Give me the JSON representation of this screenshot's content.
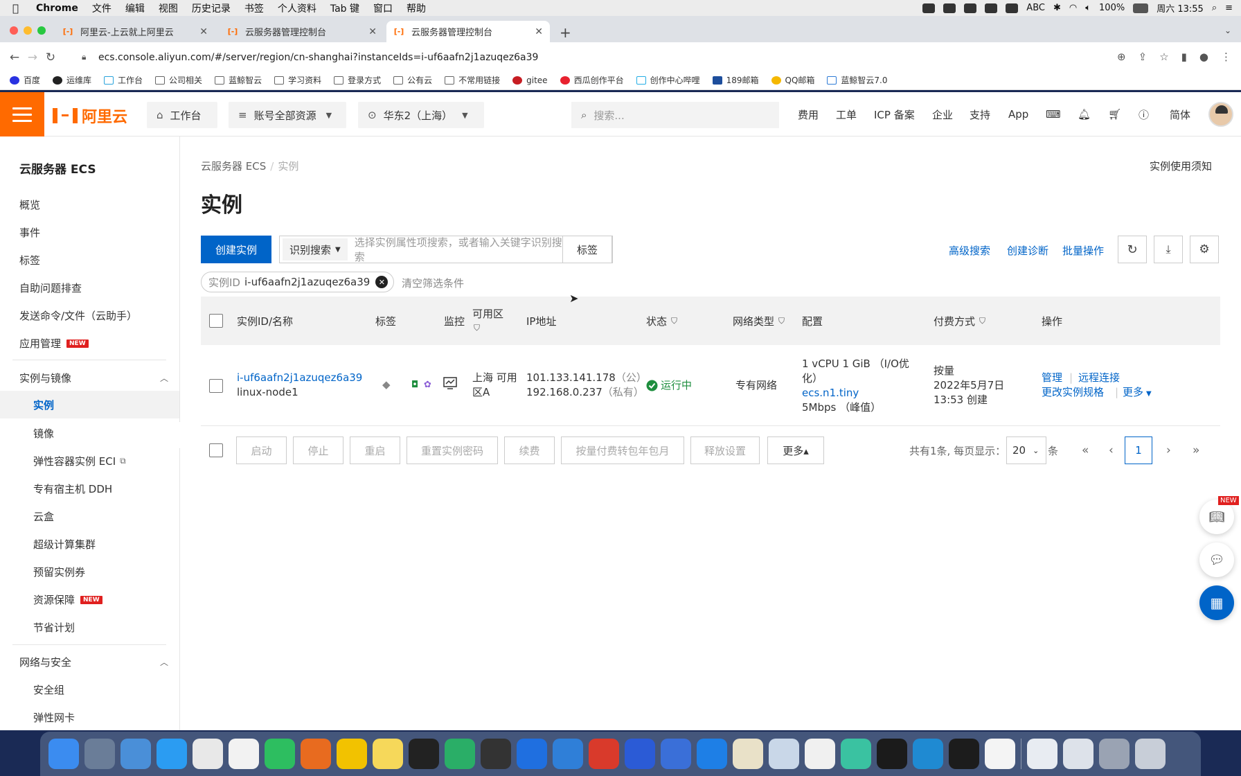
{
  "menubar": {
    "app": "Chrome",
    "items": [
      "文件",
      "编辑",
      "视图",
      "历史记录",
      "书签",
      "个人资料",
      "Tab 键",
      "窗口",
      "帮助"
    ],
    "status_abc": "ABC",
    "battery": "100%",
    "clock": "周六 13:55"
  },
  "browser": {
    "tabs": [
      {
        "label": "阿里云-上云就上阿里云"
      },
      {
        "label": "云服务器管理控制台"
      },
      {
        "label": "云服务器管理控制台"
      }
    ],
    "url": "ecs.console.aliyun.com/#/server/region/cn-shanghai?instanceIds=i-uf6aafn2j1azuqez6a39",
    "bookmarks": [
      "百度",
      "运维库",
      "工作台",
      "公司相关",
      "蓝鲸智云",
      "学习资料",
      "登录方式",
      "公有云",
      "不常用链接",
      "gitee",
      "西瓜创作平台",
      "创作中心哔哩",
      "189邮箱",
      "QQ邮箱",
      "蓝鲸智云7.0"
    ]
  },
  "header": {
    "logo": "阿里云",
    "workbench": "工作台",
    "resources": "账号全部资源",
    "region": "华东2（上海）",
    "search_placeholder": "搜索...",
    "nav": [
      "费用",
      "工单",
      "ICP 备案",
      "企业",
      "支持",
      "App"
    ],
    "lang": "简体"
  },
  "sidebar": {
    "title": "云服务器 ECS",
    "items": [
      "概览",
      "事件",
      "标签",
      "自助问题排查",
      "发送命令/文件（云助手）",
      "应用管理"
    ],
    "new_badge": "NEW",
    "group1": "实例与镜像",
    "group1_items": [
      "实例",
      "镜像",
      "弹性容器实例 ECI",
      "专有宿主机 DDH",
      "云盒",
      "超级计算集群",
      "预留实例券",
      "资源保障",
      "节省计划"
    ],
    "group2": "网络与安全",
    "group2_items": [
      "安全组",
      "弹性网卡"
    ]
  },
  "main": {
    "breadcrumb": [
      "云服务器 ECS",
      "实例"
    ],
    "title": "实例",
    "notice": "实例使用须知",
    "create_button": "创建实例",
    "search_select": "识别搜索",
    "search_placeholder": "选择实例属性项搜索，或者输入关键字识别搜索",
    "tag_button": "标签",
    "links": [
      "高级搜索",
      "创建诊断",
      "批量操作"
    ],
    "filter_key": "实例ID",
    "filter_value": "i-uf6aafn2j1azuqez6a39",
    "clear_filters": "清空筛选条件",
    "columns": [
      "实例ID/名称",
      "标签",
      "监控",
      "可用区",
      "IP地址",
      "状态",
      "网络类型",
      "配置",
      "付费方式",
      "操作"
    ],
    "rows": [
      {
        "id": "i-uf6aafn2j1azuqez6a39",
        "name": "linux-node1",
        "zone_l1": "上海 可用",
        "zone_l2": "区A",
        "ip_public": "101.133.141.178",
        "ip_public_tag": "（公）",
        "ip_private": "192.168.0.237",
        "ip_private_tag": "（私有）",
        "status": "运行中",
        "network": "专有网络",
        "config_l1": "1 vCPU 1 GiB （I/O优",
        "config_l2": "化）",
        "config_type": "ecs.n1.tiny",
        "config_bw": "5Mbps （峰值）",
        "billing_l1": "按量",
        "billing_l2": "2022年5月7日",
        "billing_l3": "13:53 创建",
        "actions": [
          "管理",
          "远程连接",
          "更改实例规格",
          "更多"
        ]
      }
    ],
    "footer_buttons": [
      "启动",
      "停止",
      "重启",
      "重置实例密码",
      "续费",
      "按量付费转包年包月",
      "释放设置",
      "更多▴"
    ],
    "page_info": "共有1条, 每页显示：",
    "page_size": "20",
    "page_unit": "条",
    "current_page": "1"
  },
  "float_badge": "NEW",
  "colors": {
    "brand": "#ff6a00",
    "primary": "#0064c8",
    "success": "#1e8e3e"
  }
}
